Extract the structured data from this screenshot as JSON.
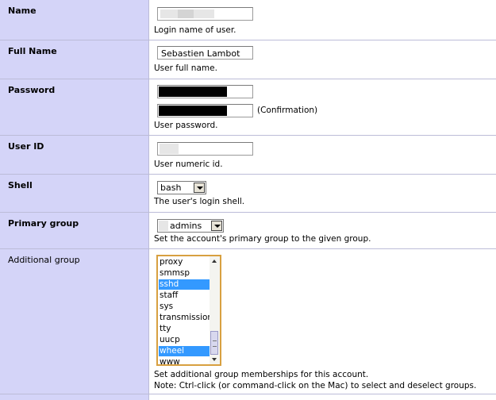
{
  "fields": {
    "name": {
      "label": "Name",
      "help": "Login name of user."
    },
    "full_name": {
      "label": "Full Name",
      "value": "Sebastien Lambot",
      "help": "User full name."
    },
    "password": {
      "label": "Password",
      "confirmation": "(Confirmation)",
      "help": "User password."
    },
    "user_id": {
      "label": "User ID",
      "help": "User numeric id."
    },
    "shell": {
      "label": "Shell",
      "value": "bash",
      "help": "The user's login shell."
    },
    "primary_group": {
      "label": "Primary group",
      "value": "admins",
      "help": "Set the account's primary group to the given group."
    },
    "additional_group": {
      "label": "Additional group",
      "options": [
        {
          "label": "proxy",
          "selected": false
        },
        {
          "label": "smmsp",
          "selected": false
        },
        {
          "label": "sshd",
          "selected": true
        },
        {
          "label": "staff",
          "selected": false
        },
        {
          "label": "sys",
          "selected": false
        },
        {
          "label": "transmission",
          "selected": false
        },
        {
          "label": "tty",
          "selected": false
        },
        {
          "label": "uucp",
          "selected": false
        },
        {
          "label": "wheel",
          "selected": true
        },
        {
          "label": "www",
          "selected": false
        }
      ],
      "help_line1": "Set additional group memberships for this account.",
      "help_line2": "Note: Ctrl-click (or command-click on the Mac) to select and deselect groups."
    }
  },
  "colors": {
    "label_bg": "#d4d4f8",
    "selection": "#3399ff",
    "listbox_border": "#d8a040"
  }
}
